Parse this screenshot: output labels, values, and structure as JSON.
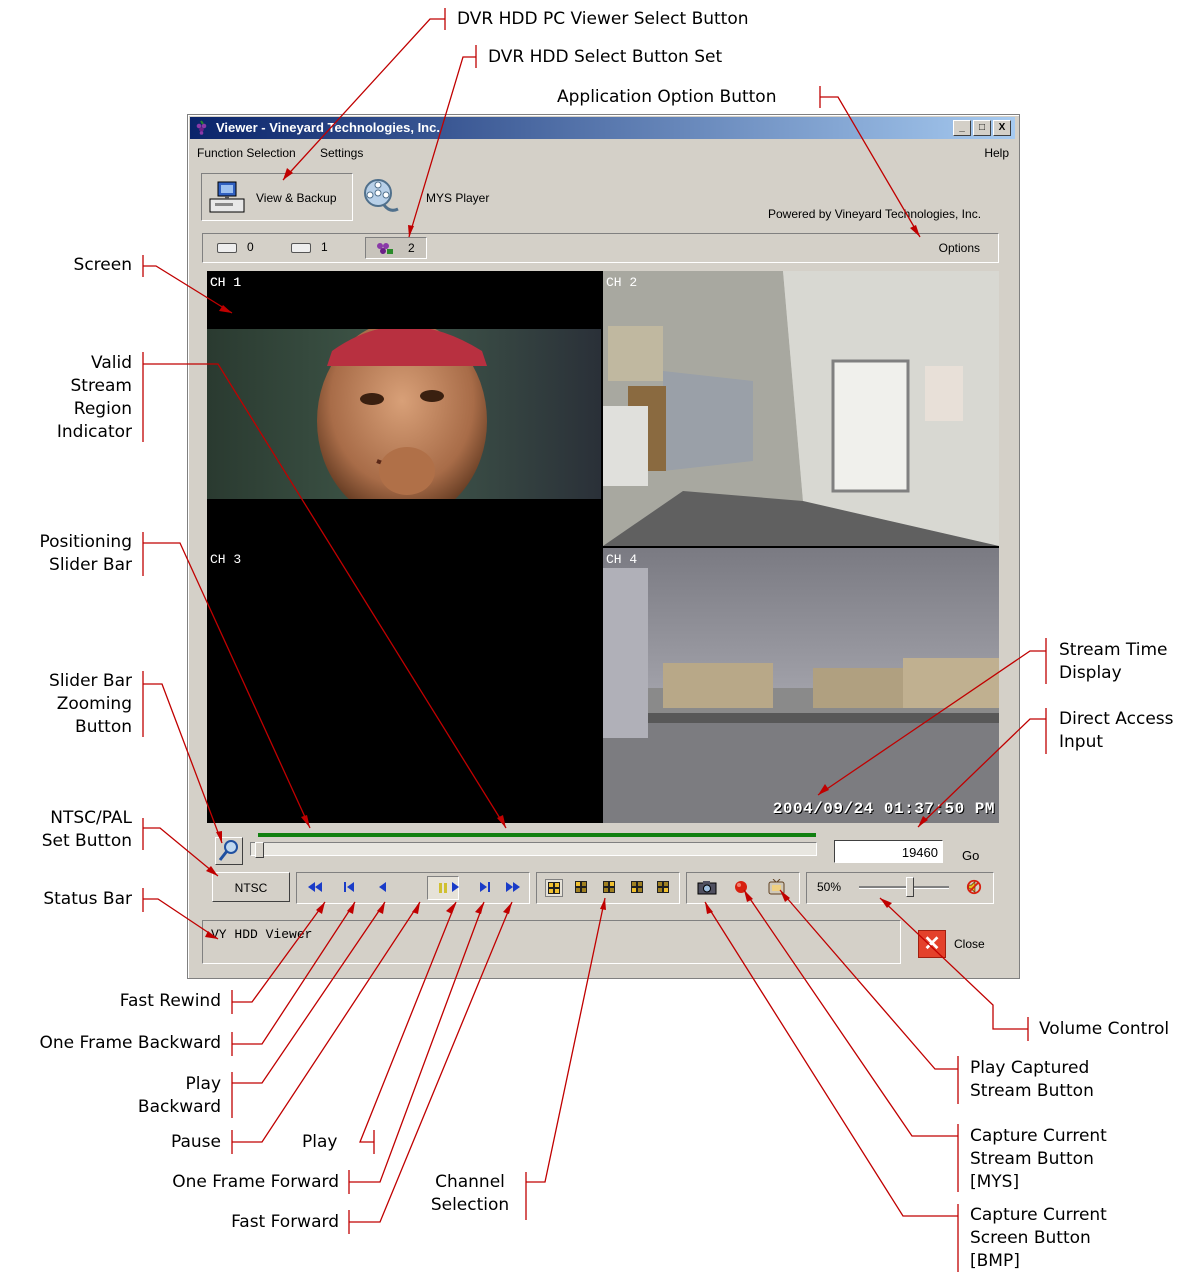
{
  "window": {
    "title": "Viewer - Vineyard Technologies, Inc.",
    "controls": [
      "_",
      "□",
      "X"
    ]
  },
  "menu": {
    "function_selection": "Function Selection",
    "settings": "Settings",
    "help": "Help"
  },
  "toolbar": {
    "view_backup": "View & Backup",
    "mys_player": "MYS Player",
    "powered_by": "Powered by Vineyard Technologies, Inc."
  },
  "hdd_buttons": [
    "0",
    "1",
    "2"
  ],
  "options_label": "Options",
  "channels": [
    "CH 1",
    "CH 2",
    "CH 3",
    "CH 4"
  ],
  "timestamp": "2004/09/24 01:37:50 PM",
  "direct_access_value": "19460",
  "go_label": "Go",
  "ntsc_label": "NTSC",
  "volume_percent": "50%",
  "volume_level": 0.55,
  "status_text": "VY HDD Viewer",
  "close_label": "Close",
  "callouts": {
    "pc_viewer": "DVR HDD PC Viewer Select Button",
    "hdd_select": "DVR HDD Select Button Set",
    "app_option": "Application Option Button",
    "screen": "Screen",
    "valid_stream": [
      "Valid",
      "Stream",
      "Region",
      "Indicator"
    ],
    "positioning": [
      "Positioning",
      "Slider Bar"
    ],
    "zooming": [
      "Slider Bar",
      "Zooming",
      "Button"
    ],
    "ntsc_pal": [
      "NTSC/PAL",
      "Set Button"
    ],
    "status_bar": "Status Bar",
    "stream_time": [
      "Stream Time",
      "Display"
    ],
    "direct_access": [
      "Direct Access",
      "Input"
    ],
    "fast_rewind": "Fast Rewind",
    "one_frame_backward": "One Frame Backward",
    "play_backward": [
      "Play",
      "Backward"
    ],
    "pause": "Pause",
    "play": "Play",
    "one_frame_forward": "One Frame Forward",
    "fast_forward": "Fast Forward",
    "channel_selection": [
      "Channel",
      "Selection"
    ],
    "volume_control": "Volume Control",
    "play_captured": [
      "Play Captured",
      "Stream Button"
    ],
    "capture_stream": [
      "Capture Current",
      "Stream Button",
      "[MYS]"
    ],
    "capture_screen": [
      "Capture Current",
      "Screen Button",
      "[BMP]"
    ]
  }
}
